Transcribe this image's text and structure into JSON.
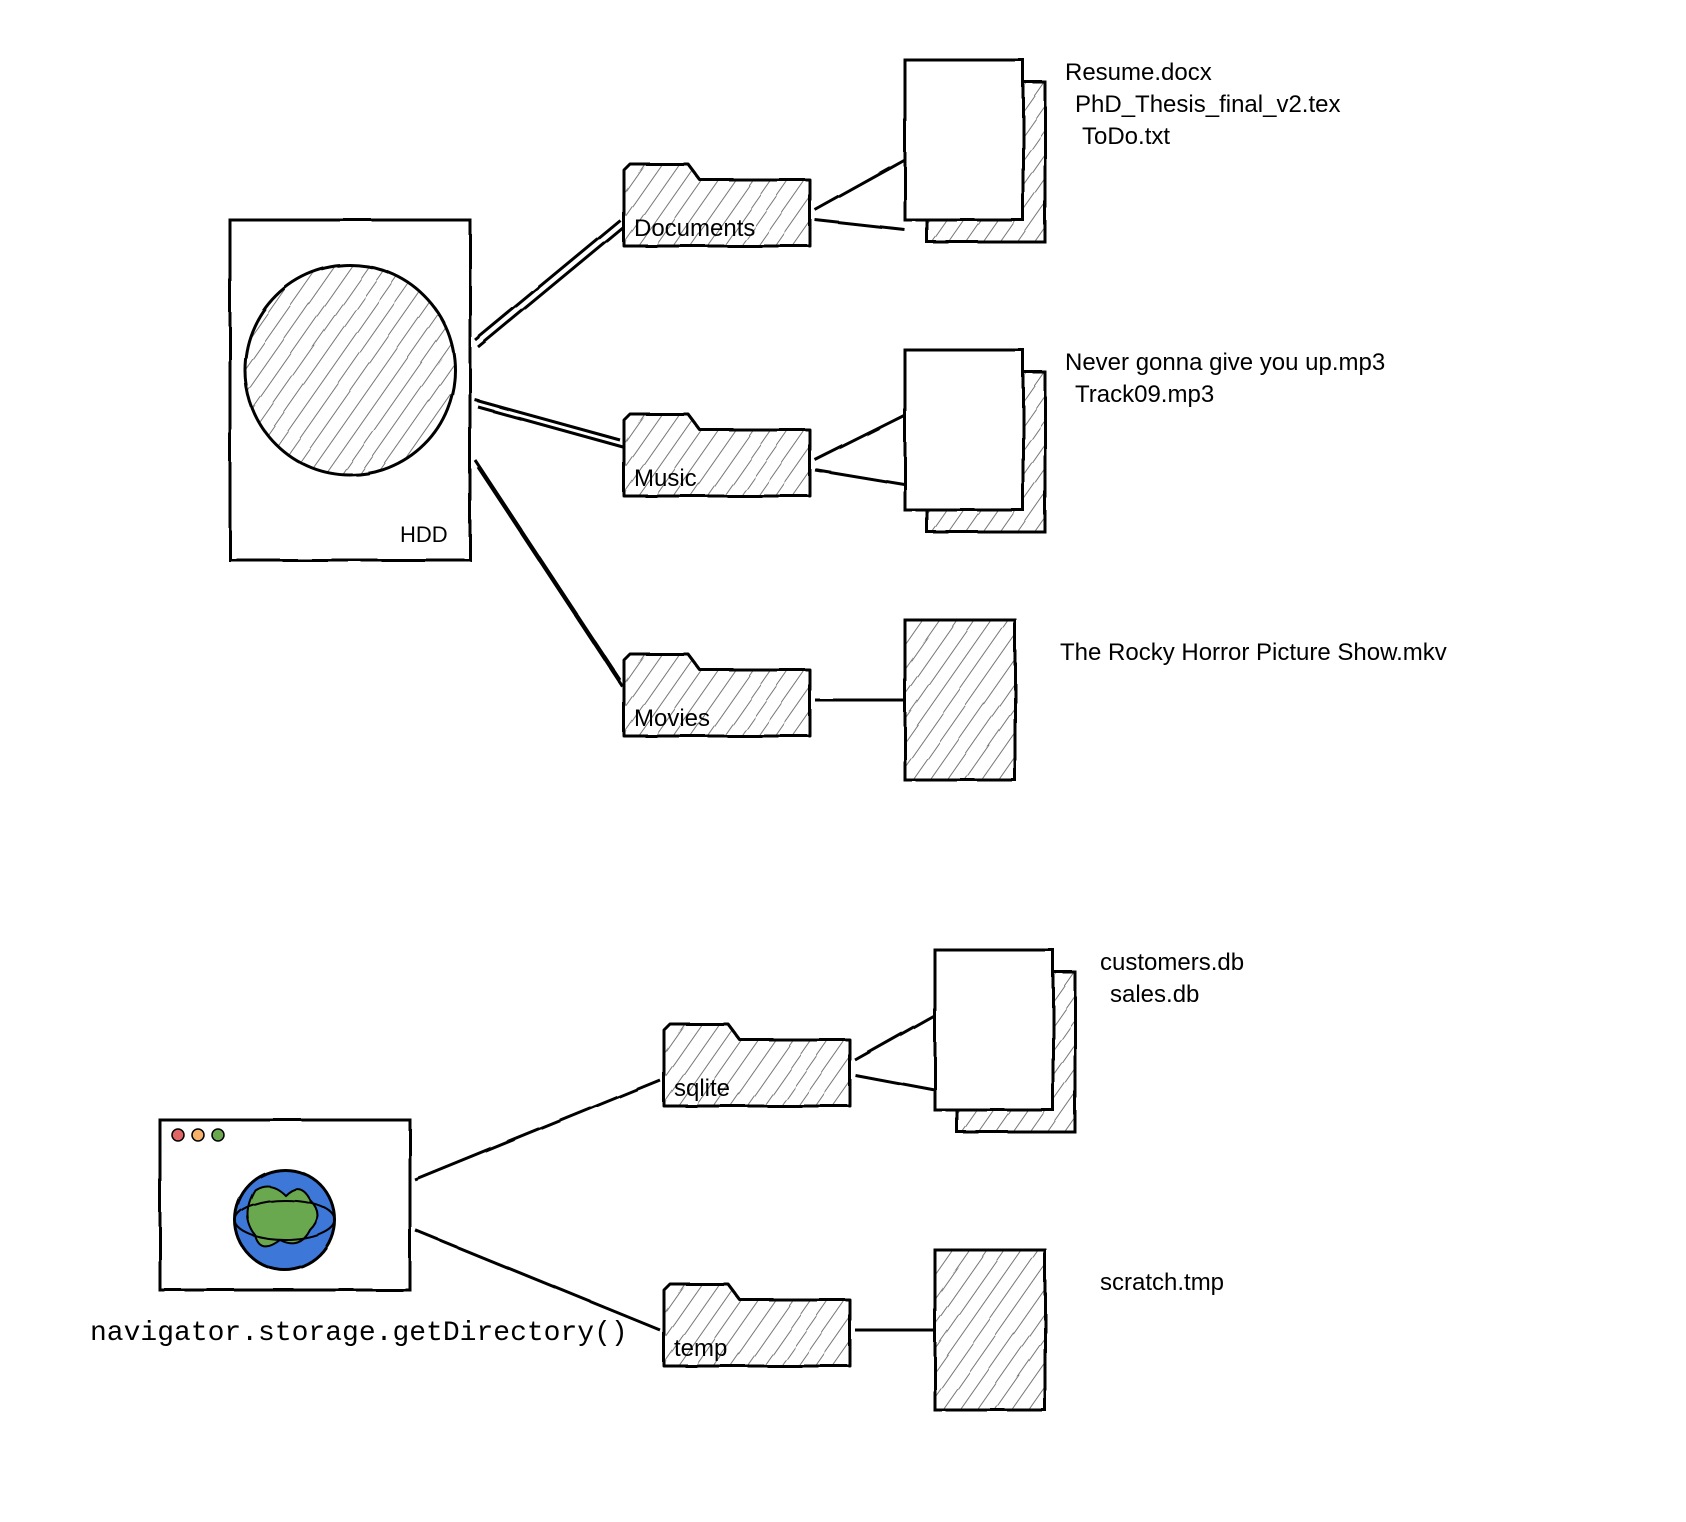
{
  "hdd": {
    "label": "HDD",
    "folders": [
      {
        "name": "Documents",
        "files": [
          "Resume.docx",
          "PhD_Thesis_final_v2.tex",
          "ToDo.txt"
        ]
      },
      {
        "name": "Music",
        "files": [
          "Never gonna give you up.mp3",
          "Track09.mp3"
        ]
      },
      {
        "name": "Movies",
        "files": [
          "The Rocky Horror Picture Show.mkv"
        ]
      }
    ]
  },
  "browser": {
    "api_call": "navigator.storage.getDirectory()",
    "folders": [
      {
        "name": "sqlite",
        "files": [
          "customers.db",
          "sales.db"
        ]
      },
      {
        "name": "temp",
        "files": [
          "scratch.tmp"
        ]
      }
    ]
  }
}
